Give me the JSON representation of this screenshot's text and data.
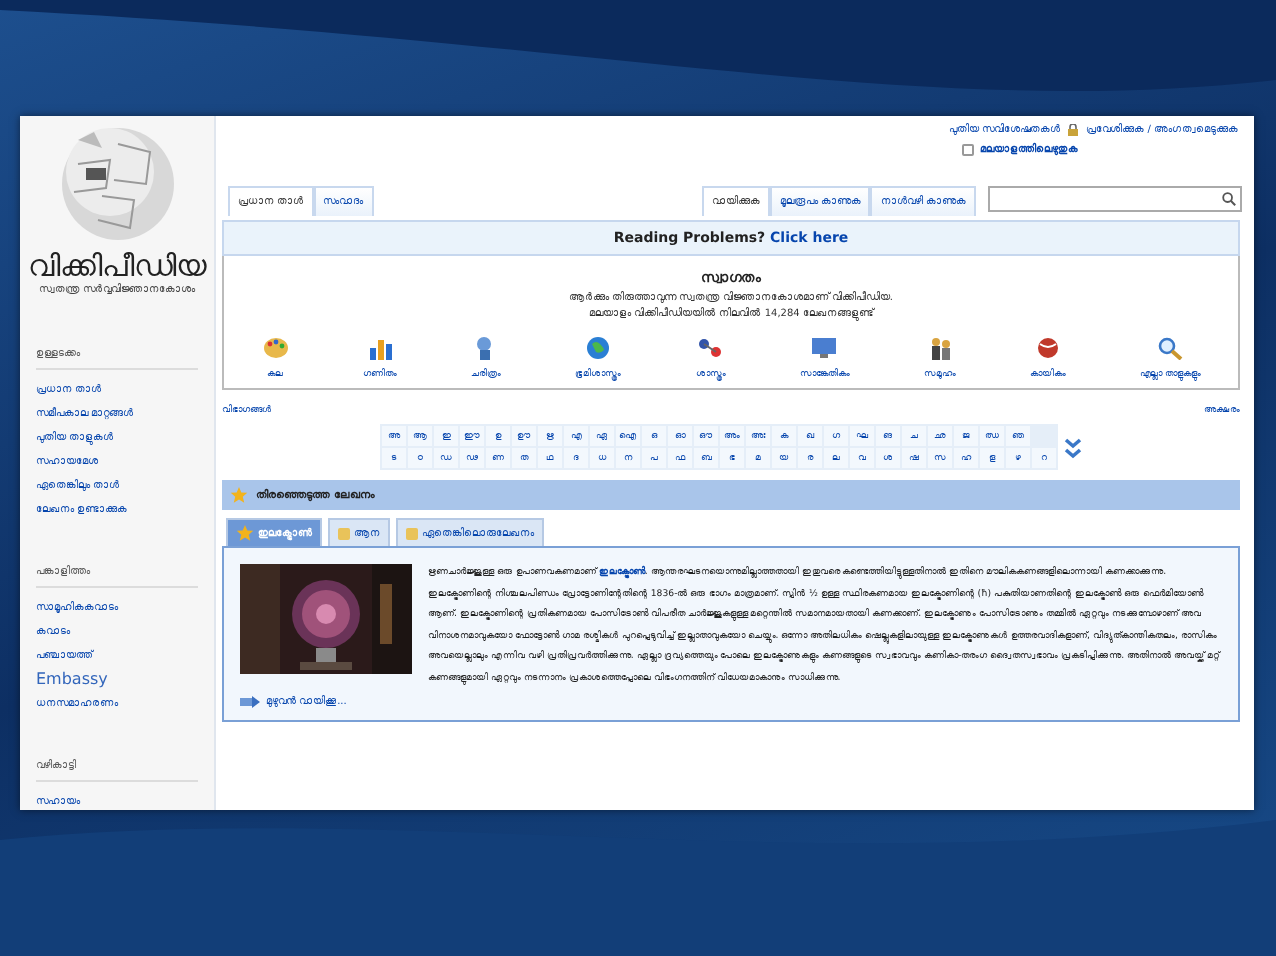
{
  "sidebar": {
    "logo_title": "വിക്കിപീഡിയ",
    "logo_tagline": "സ്വതന്ത്ര സർവ്വവിജ്ഞാനകോശം",
    "groups": [
      {
        "heading": "ഉള്ളടക്കം",
        "items": [
          "പ്രധാന താൾ",
          "സമീപകാല മാറ്റങ്ങൾ",
          "പുതിയ താളുകൾ",
          "സഹായമേശ",
          "ഏതെങ്കിലും താൾ",
          "ലേഖനം ഉണ്ടാക്കുക"
        ]
      },
      {
        "heading": "പങ്കാളിത്തം",
        "items": [
          "സാമൂഹികകവാടം",
          "കവാടം",
          "പഞ്ചായത്ത്",
          "Embassy",
          "ധനസമാഹരണം"
        ]
      },
      {
        "heading": "വഴികാട്ടി",
        "items": [
          "സഹായം"
        ]
      }
    ]
  },
  "header": {
    "personal_links": [
      "പുതിയ സവിശേഷതകൾ",
      "പ്രവേശിക്കുക / അംഗത്വമെടുക്കുക"
    ],
    "typing_option": {
      "label": "മലയാളത്തിലെഴുതുക",
      "checked": false
    },
    "left_tabs": [
      {
        "label": "പ്രധാന താൾ",
        "selected": true
      },
      {
        "label": "സംവാദം",
        "selected": false
      }
    ],
    "right_tabs": [
      {
        "label": "വായിക്കുക",
        "selected": true
      },
      {
        "label": "മൂലരൂപം കാണുക",
        "selected": false
      },
      {
        "label": "നാൾവഴി കാണുക",
        "selected": false
      }
    ]
  },
  "notice": {
    "text": "Reading Problems?",
    "link": "Click here"
  },
  "welcome": {
    "title": "സ്വാഗതം",
    "line_1": "ആർക്കും തിരുത്താവുന്ന സ്വതന്ത്ര വിജ്ഞാനകോശമാണ് വിക്കിപീഡിയ.",
    "line_2": "മലയാളം വിക്കിപീഡിയയിൽ നിലവിൽ 14,284 ലേഖനങ്ങളുണ്ട്",
    "portals": [
      "കല",
      "ഗണിതം",
      "ചരിത്രം",
      "ഭൂമിശാസ്ത്രം",
      "ശാസ്ത്രം",
      "സാങ്കേതികം",
      "സമൂഹം",
      "കായികം",
      "എല്ലാ താളുകളും"
    ]
  },
  "index_link_left": "വിഭാഗങ്ങൾ",
  "index_link_right": "അക്ഷരം",
  "alphabet": [
    [
      "അ",
      "ആ",
      "ഇ",
      "ഈ",
      "ഉ",
      "ഊ",
      "ഋ",
      "എ",
      "ഏ",
      "ഐ",
      "ഒ",
      "ഓ",
      "ഔ",
      "അം",
      "അഃ",
      "ക",
      "ഖ",
      "ഗ",
      "ഘ",
      "ങ",
      "ച",
      "ഛ",
      "ജ",
      "ഝ",
      "ഞ"
    ],
    [
      "ട",
      "ഠ",
      "ഡ",
      "ഢ",
      "ണ",
      "ത",
      "ഥ",
      "ദ",
      "ധ",
      "ന",
      "പ",
      "ഫ",
      "ബ",
      "ഭ",
      "മ",
      "യ",
      "ര",
      "ല",
      "വ",
      "ശ",
      "ഷ",
      "സ",
      "ഹ",
      "ള",
      "ഴ",
      "റ"
    ]
  ],
  "featured": {
    "heading": "തിരഞ്ഞെടുത്ത ലേഖനം",
    "tabs": [
      {
        "label": "ഇലക്ട്രോൺ",
        "selected": true
      },
      {
        "label": "ആന",
        "selected": false
      },
      {
        "label": "ഏതെങ്കിലൊരുലേഖനം",
        "selected": false
      }
    ],
    "article": "ഋണചാർജ്ജുള്ള ഒരു ഉപാണവകണമാണ് **ഇലക്ട്രോൺ**. ആന്തരഘടനയൊന്നുമില്ലാത്തതായി ഇതുവരെ കണ്ടെത്തിയിട്ടുള്ളതിനാൽ ഇതിനെ മൗലികകണങ്ങളിലൊന്നായി കണക്കാക്കുന്നു. ഇലക്ട്രോണിന്റെ നിശ്ചലപിണ്ഡം പ്രോട്ടോണിന്റേതിന്റെ 1836-ൽ ഒരു ഭാഗം മാത്രമാണ്. സ്പിൻ ½ ഉള്ള സ്ഥിരകണമായ ഇലക്ട്രോണിന്റെ (ħ) പകുതിയാണതിന്റെ ഇലക്ട്രോൺ ഒരു ഫെർമിയോൺ ആണ്. ഇലക്ട്രോണിന്റെ പ്രതികണമായ പോസിട്രോൺ വിപരീത ചാർജ്ജുകളുള്ള മറ്റെന്തിൽ സമാനമായതായി കണക്കാണ്. ഇലക്ട്രോണും പോസിട്രോണും തമ്മിൽ ഏറ്റവും നടക്കുമ്പോഴാണ് അവ വിനാശനമാവുകയോ ഫോട്ടോൺ ഗാമ രശ്മികൾ പുറപ്പെടുവിച്ച് ഇല്ലാതാവുകയോ ചെയ്യും. ഒന്നോ അതിലധികം ഷെല്ലുകളിലായുള്ള ഇലക്ട്രോണുകൾ ഉത്തരവാദികളാണ്, വിദ്യുത്കാന്തികതലം, രാസികം അവയെല്ലാലും എന്നിവ വഴി പ്രതിപ്രവർത്തിക്കുന്നു. ഏല്ലാ ദ്രവ്യത്തെയും പോലെ ഇലക്ട്രോണുകളും കണങ്ങളുടെ സ്വഭാവവും കണികാ-തരംഗ ദ്വൈതസ്വഭാവം പ്രകടിപ്പിക്കുന്നു. അതിനാൽ അവയ്ക്ക് മറ്റ് കണങ്ങളുമായി ഏറ്റവും നടന്നാനം പ്രകാശത്തെപ്പോലെ വിഭംഗനത്തിന് വിധേയമാകാനും സാധിക്കുന്നു.",
    "more": "മുഴുവൻ വായിക്കൂ..."
  }
}
